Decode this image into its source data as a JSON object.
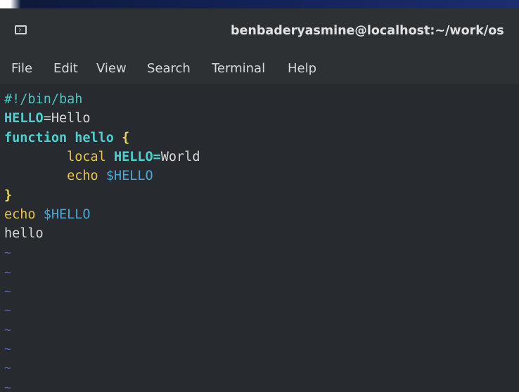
{
  "window": {
    "title": "benbaderyasmine@localhost:~/work/os"
  },
  "menu": {
    "items": [
      "File",
      "Edit",
      "View",
      "Search",
      "Terminal",
      "Help"
    ]
  },
  "editor": {
    "lines": [
      [
        {
          "t": "#!/bin/bah",
          "c": "comment"
        }
      ],
      [
        {
          "t": "HELLO",
          "c": "var"
        },
        {
          "t": "=Hello",
          "c": "text"
        }
      ],
      [
        {
          "t": "function hello ",
          "c": "keyword"
        },
        {
          "t": "{",
          "c": "brace"
        }
      ],
      [
        {
          "t": "        local ",
          "c": "builtin"
        },
        {
          "t": "HELLO=",
          "c": "var"
        },
        {
          "t": "World",
          "c": "text"
        }
      ],
      [
        {
          "t": "        echo ",
          "c": "builtin"
        },
        {
          "t": "$HELLO",
          "c": "dollar"
        }
      ],
      [
        {
          "t": "}",
          "c": "brace"
        }
      ],
      [
        {
          "t": "echo ",
          "c": "builtin"
        },
        {
          "t": "$HELLO",
          "c": "dollar"
        }
      ],
      [
        {
          "t": "hello",
          "c": "text"
        }
      ]
    ],
    "empty_line_marker": "~",
    "empty_line_count": 8
  },
  "colors": {
    "background": "#272a2e",
    "titlebar": "#2e3134",
    "comment": "#4fc3c3",
    "keyword": "#4fd0d0",
    "builtin": "#e6c64a",
    "dollar": "#4fa8d8",
    "brace": "#e8d25b",
    "tilde": "#5a6cc0"
  },
  "icons": {
    "window": "terminal-icon"
  }
}
